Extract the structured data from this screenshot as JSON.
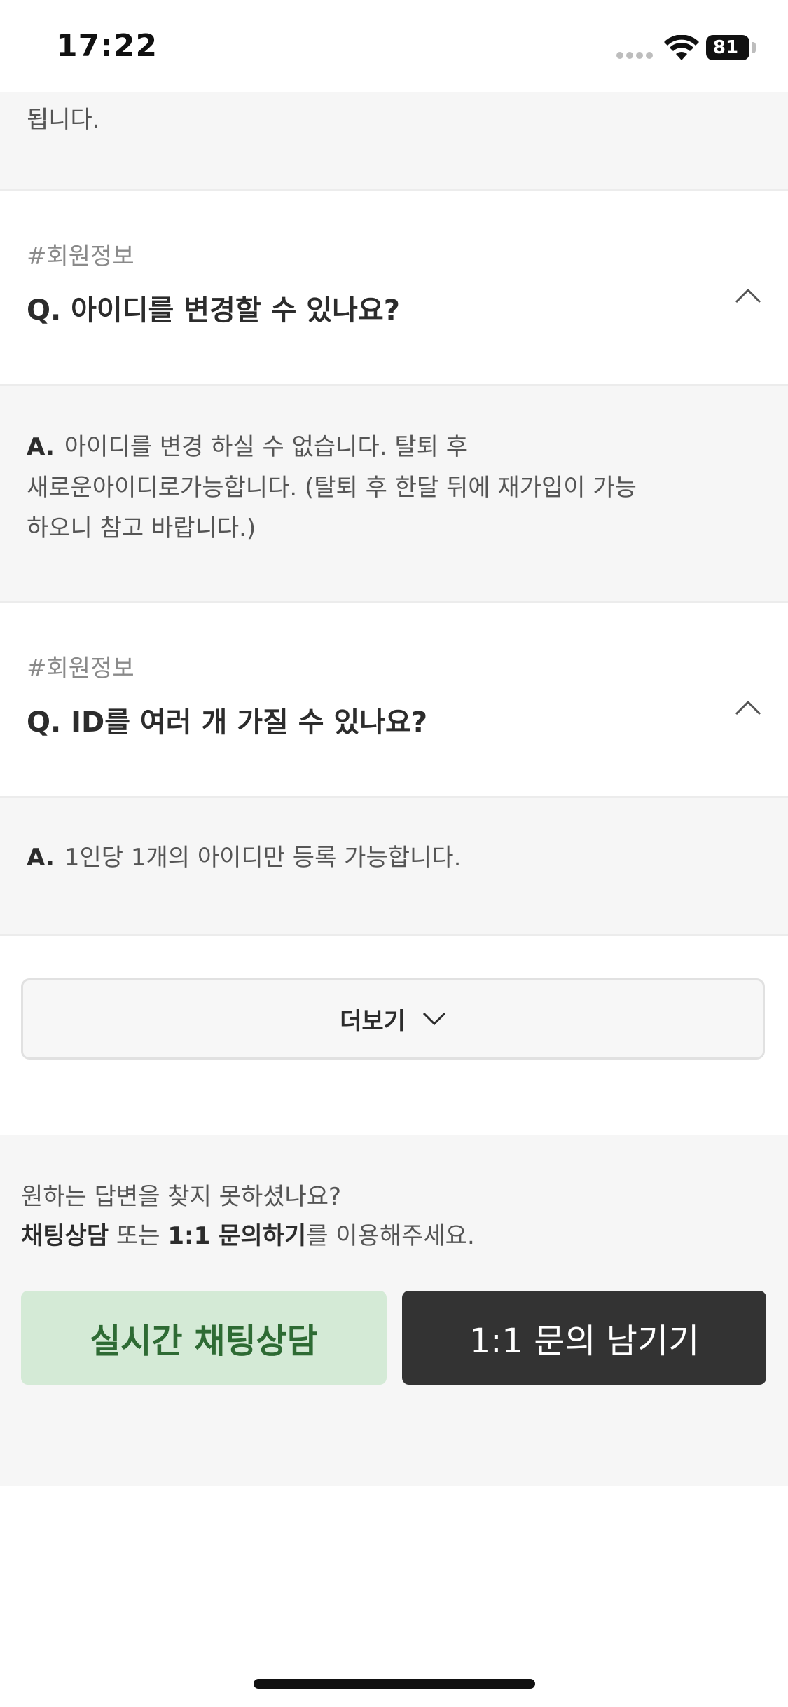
{
  "status_bar": {
    "time": "17:22",
    "battery": "81"
  },
  "faq": {
    "partial_answer_tail": "됩니다.",
    "items": [
      {
        "tag": "#회원정보",
        "question": "Q. 아이디를 변경할 수 있나요?",
        "answer_prefix": "A.",
        "answer_lines": [
          "아이디를 변경 하실 수 없습니다. 탈퇴 후",
          "새로운아이디로가능합니다. (탈퇴 후 한달 뒤에 재가입이 가능",
          "하오니 참고 바랍니다.)"
        ]
      },
      {
        "tag": "#회원정보",
        "question": "Q. ID를 여러 개 가질 수 있나요?",
        "answer_prefix": "A.",
        "answer_lines": [
          "1인당 1개의 아이디만 등록 가능합니다."
        ]
      }
    ],
    "more_label": "더보기"
  },
  "help": {
    "line1": "원하는 답변을 찾지 못하셨나요?",
    "line2_bold1": "채팅상담",
    "line2_mid": " 또는 ",
    "line2_bold2": "1:1 문의하기",
    "line2_end": "를 이용해주세요.",
    "chat_button": "실시간 채팅상담",
    "inquiry_button": "1:1 문의 남기기"
  },
  "colors": {
    "chat_bg": "#d4ead6",
    "chat_text": "#2e6b34",
    "inquiry_bg": "#333333"
  }
}
